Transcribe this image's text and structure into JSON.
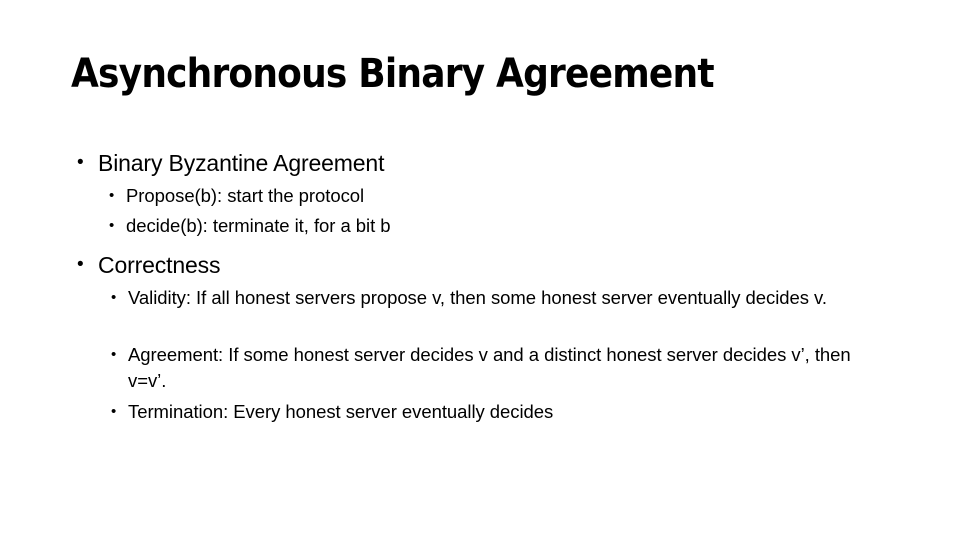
{
  "slide": {
    "title": "Asynchronous Binary Agreement",
    "bullet_glyph": "•",
    "text_color": "#000000",
    "background_color": "#ffffff",
    "content": [
      {
        "level": 1,
        "text": "Binary Byzantine Agreement"
      },
      {
        "level": 2,
        "text": "Propose(b): start the protocol"
      },
      {
        "level": 2,
        "text": "decide(b): terminate it, for a bit b"
      },
      {
        "level": 1,
        "text": "Correctness"
      },
      {
        "level": 2,
        "text": "Validity: If all honest servers propose v, then some honest server eventually decides v."
      },
      {
        "level": 2,
        "text": "Agreement: If some honest server decides v and a distinct honest server decides v’, then v=v’."
      },
      {
        "level": 2,
        "text": "Termination: Every honest server eventually decides"
      }
    ]
  }
}
